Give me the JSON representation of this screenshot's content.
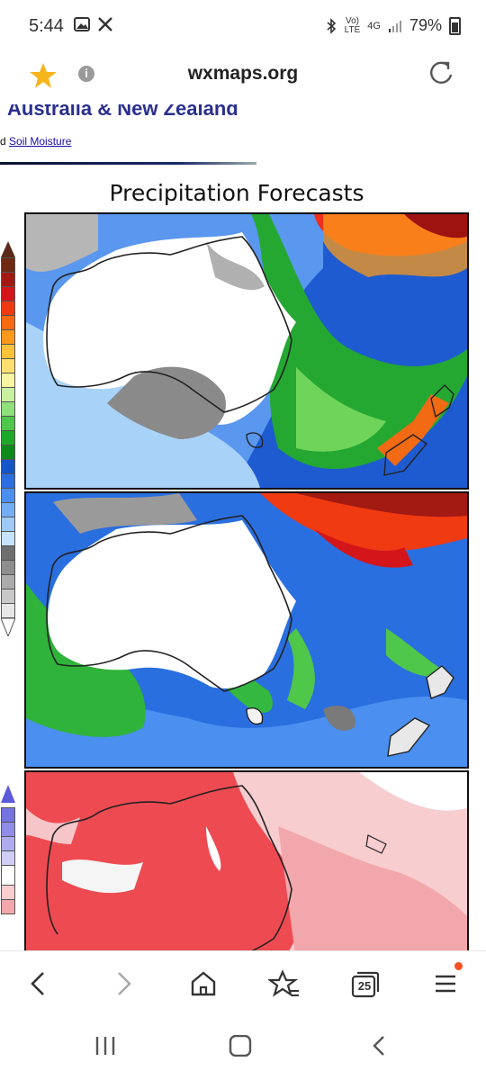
{
  "status": {
    "time": "5:44",
    "network": "4G",
    "lte": "LTE",
    "battery": "79%"
  },
  "browser": {
    "url": "wxmaps.org"
  },
  "page": {
    "site_title": "Australia & New Zealand",
    "nav_prefix": "d",
    "nav_link": "Soil Moisture",
    "figure_title": "Precipitation Forecasts"
  },
  "tabs_count": "25",
  "colors": {
    "title_blue": "#2a2f8f",
    "accent_orange": "#f4511e"
  }
}
